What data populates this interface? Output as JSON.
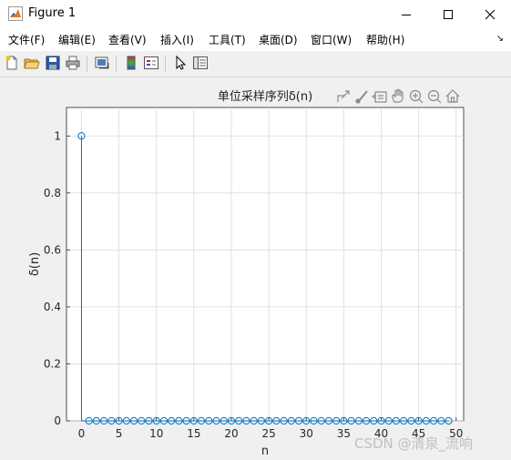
{
  "window": {
    "title": "Figure 1",
    "controls": [
      "minimize",
      "maximize",
      "close"
    ]
  },
  "menu": {
    "items": [
      "文件(F)",
      "编辑(E)",
      "查看(V)",
      "插入(I)",
      "工具(T)",
      "桌面(D)",
      "窗口(W)",
      "帮助(H)"
    ],
    "overflow_glyph": "↘"
  },
  "toolbar": {
    "buttons": [
      "new-figure-icon",
      "open-file-icon",
      "save-icon",
      "print-icon",
      "link-plot-icon",
      "colorbar-icon",
      "legend-icon",
      "pointer-icon",
      "property-editor-icon"
    ]
  },
  "axes_toolbar": {
    "buttons": [
      "export-icon",
      "brush-icon",
      "data-tips-icon",
      "pan-icon",
      "zoom-in-icon",
      "zoom-out-icon",
      "home-icon"
    ]
  },
  "chart_data": {
    "type": "stem",
    "title": "单位采样序列δ(n)",
    "xlabel": "n",
    "ylabel": "δ(n)",
    "x": [
      0,
      1,
      2,
      3,
      4,
      5,
      6,
      7,
      8,
      9,
      10,
      11,
      12,
      13,
      14,
      15,
      16,
      17,
      18,
      19,
      20,
      21,
      22,
      23,
      24,
      25,
      26,
      27,
      28,
      29,
      30,
      31,
      32,
      33,
      34,
      35,
      36,
      37,
      38,
      39,
      40,
      41,
      42,
      43,
      44,
      45,
      46,
      47,
      48,
      49
    ],
    "y": [
      1,
      0,
      0,
      0,
      0,
      0,
      0,
      0,
      0,
      0,
      0,
      0,
      0,
      0,
      0,
      0,
      0,
      0,
      0,
      0,
      0,
      0,
      0,
      0,
      0,
      0,
      0,
      0,
      0,
      0,
      0,
      0,
      0,
      0,
      0,
      0,
      0,
      0,
      0,
      0,
      0,
      0,
      0,
      0,
      0,
      0,
      0,
      0,
      0,
      0
    ],
    "xlim": [
      -2,
      51
    ],
    "ylim": [
      0,
      1.1
    ],
    "xticks": [
      0,
      5,
      10,
      15,
      20,
      25,
      30,
      35,
      40,
      45,
      50
    ],
    "yticks": [
      0,
      0.2,
      0.4,
      0.6,
      0.8,
      1
    ],
    "grid": true,
    "marker_color": "#0072bd"
  },
  "watermark": "CSDN @清泉_流响"
}
